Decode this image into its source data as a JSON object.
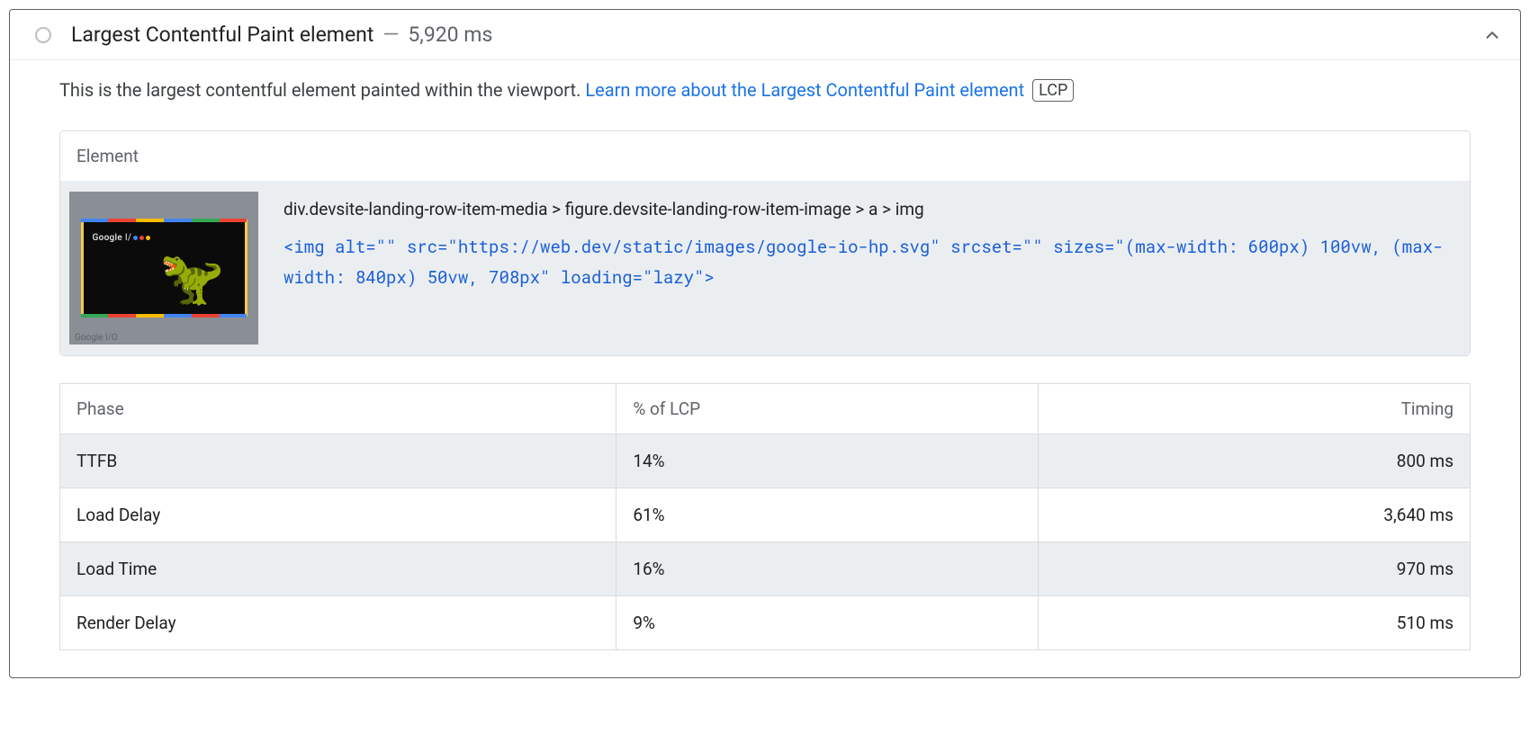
{
  "audit": {
    "title": "Largest Contentful Paint element",
    "timing": "5,920 ms",
    "description_prefix": "This is the largest contentful element painted within the viewport. ",
    "learn_more": "Learn more about the Largest Contentful Paint element",
    "badge": "LCP"
  },
  "element": {
    "section_label": "Element",
    "selector": "div.devsite-landing-row-item-media > figure.devsite-landing-row-item-image > a > img",
    "snippet": "<img alt=\"\" src=\"https://web.dev/static/images/google-io-hp.svg\" srcset=\"\" sizes=\"(max-width: 600px) 100vw, (max-width: 840px) 50vw, 708px\" loading=\"lazy\">",
    "thumb_label": "Google I/O",
    "thumb_caption": "Google I/O"
  },
  "phases": {
    "columns": {
      "c0": "Phase",
      "c1": "% of LCP",
      "c2": "Timing"
    },
    "rows": [
      {
        "phase": "TTFB",
        "pct": "14%",
        "timing": "800 ms"
      },
      {
        "phase": "Load Delay",
        "pct": "61%",
        "timing": "3,640 ms"
      },
      {
        "phase": "Load Time",
        "pct": "16%",
        "timing": "970 ms"
      },
      {
        "phase": "Render Delay",
        "pct": "9%",
        "timing": "510 ms"
      }
    ]
  }
}
